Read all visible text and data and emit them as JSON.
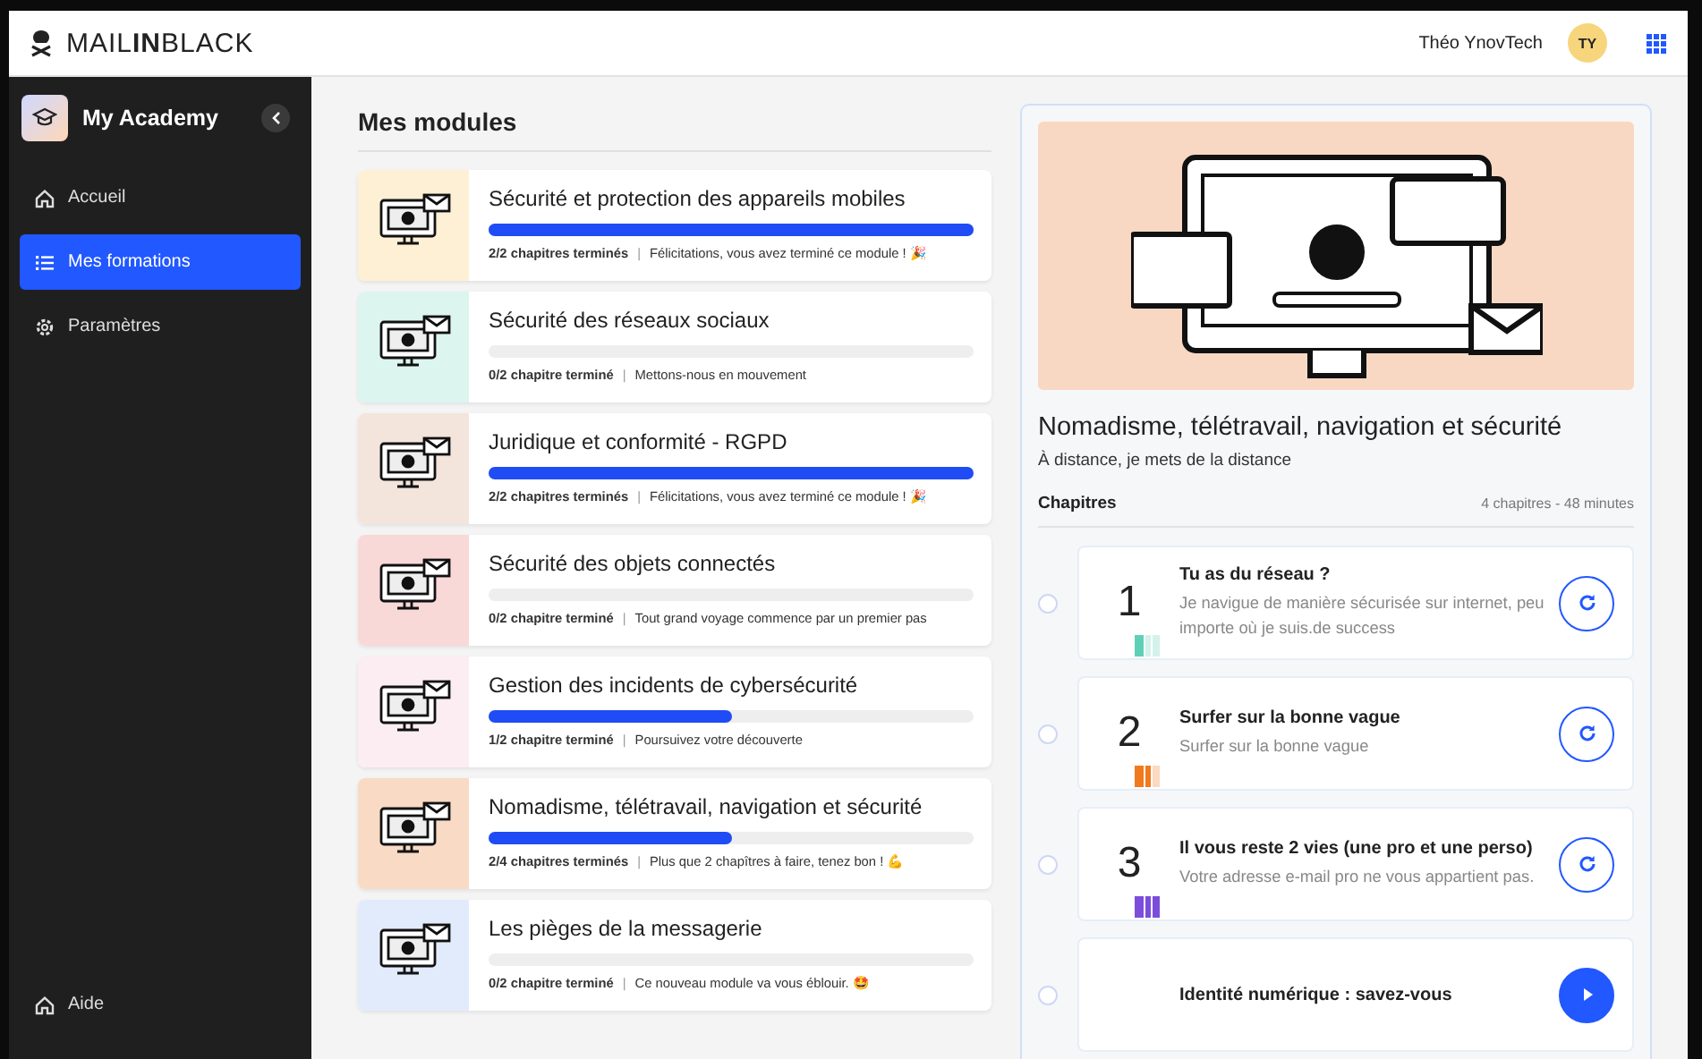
{
  "topbar": {
    "logo": "MAIL**IN**BLACK",
    "user_name": "Théo YnovTech",
    "avatar": "TY"
  },
  "sidebar": {
    "title": "My Academy",
    "items": [
      {
        "label": "Accueil",
        "selected": false
      },
      {
        "label": "Mes formations",
        "selected": true
      },
      {
        "label": "Paramètres",
        "selected": false
      }
    ],
    "footer": "Aide"
  },
  "modules": {
    "title": "Mes modules",
    "separator": "|",
    "items": [
      {
        "title": "Sécurité et protection des appareils mobiles",
        "level": 1,
        "progress": "2/2 chapitres terminés",
        "message": "Félicitations, vous avez terminé ce module ! 🎉",
        "color": "#fdf0d5"
      },
      {
        "title": "Sécurité des réseaux sociaux",
        "level": 0,
        "progress": "0/2 chapitre terminé",
        "message": "Mettons-nous en mouvement",
        "color": "#dcf5ef"
      },
      {
        "title": "Juridique et conformité - RGPD",
        "level": 1,
        "progress": "2/2 chapitres terminés",
        "message": "Félicitations, vous avez terminé ce module ! 🎉",
        "color": "#f3e5dc"
      },
      {
        "title": "Sécurité des objets connectés",
        "level": 0,
        "progress": "0/2 chapitre terminé",
        "message": "Tout grand voyage commence par un premier pas",
        "color": "#f9d8d8"
      },
      {
        "title": "Gestion des incidents de cybersécurité",
        "level": 0.5,
        "progress": "1/2 chapitre terminé",
        "message": "Poursuivez votre découverte",
        "color": "#fbedf2"
      },
      {
        "title": "Nomadisme, télétravail, navigation et sécurité",
        "level": 0.5,
        "progress": "2/4 chapitres terminés",
        "message": "Plus que 2 chapîtres à faire, tenez bon ! 💪",
        "color": "#f9dac4"
      },
      {
        "title": "Les pièges de la messagerie",
        "level": 0,
        "progress": "0/2 chapitre terminé",
        "message": "Ce nouveau module va vous éblouir. 🤩",
        "color": "#e2ebfb"
      }
    ]
  },
  "detail": {
    "title": "Nomadisme, télétravail, navigation et sécurité",
    "subtitle": "À distance, je mets de la distance",
    "chapters_label": "Chapitres",
    "chapters_info": "4 chapitres - 48 minutes",
    "chapters": [
      {
        "number": "1",
        "title": "Tu as du réseau ?",
        "description": "Je navigue de manière sécurisée sur internet, peu importe où je suis.de success",
        "level": 0.33,
        "color": "#5fd0b5",
        "kind": "replay"
      },
      {
        "number": "2",
        "title": "Surfer sur la bonne vague",
        "description": "Surfer sur la bonne vague",
        "level": 0.67,
        "color": "#f07a1e",
        "kind": "replay"
      },
      {
        "number": "3",
        "title": "Il vous reste 2 vies (une pro et une perso)",
        "description": "Votre adresse e-mail pro ne vous appartient pas.",
        "level": 1,
        "color": "#7c4ddb",
        "kind": "replay"
      },
      {
        "title": "Identité numérique : savez-vous",
        "kind": "start"
      }
    ]
  }
}
